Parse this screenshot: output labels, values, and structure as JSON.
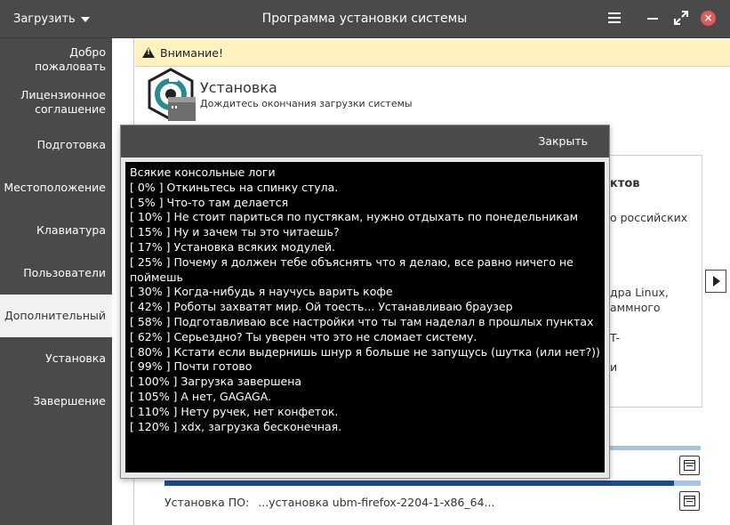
{
  "titlebar": {
    "menu_label": "Загрузить",
    "title": "Программа установки системы",
    "close_symbol": "×"
  },
  "sidebar": {
    "items": [
      {
        "label": "Добро пожаловать"
      },
      {
        "label": "Лицензионное соглашение"
      },
      {
        "label": "Подготовка"
      },
      {
        "label": "Местоположение"
      },
      {
        "label": "Клавиатура"
      },
      {
        "label": "Пользователи"
      },
      {
        "label": "Дополнительный",
        "active": true
      },
      {
        "label": "Установка"
      },
      {
        "label": "Завершение"
      }
    ]
  },
  "warning": {
    "text": "Внимание!"
  },
  "install": {
    "title": "Установка",
    "subtitle": "Дождитесь окончания загрузки системы"
  },
  "background_card": {
    "lines": [
      "ктов",
      "о российских",
      "дра Linux,",
      "аммного",
      "T-",
      "и"
    ]
  },
  "progress": {
    "fraction": 0.95,
    "status_label": "Установка ПО:",
    "status_value": "...установка ubm-firefox-2204-1-x86_64..."
  },
  "dialog": {
    "close_label": "Закрыть",
    "log_lines": [
      "Всякие консольные логи",
      "[ 0% ] Откиньтесь на спинку стула.",
      "[ 5% ] Что-то там делается",
      "[ 10% ] Не стоит париться по пустякам, нужно отдыхать по понедельникам",
      "[ 15% ] Ну и зачем ты это читаешь?",
      "[ 17% ] Установка всяких модулей.",
      "[ 25% ] Почему я должен тебе объяснять что я делаю, все равно ничего не поймешь",
      "[ 30% ] Когда-нибудь я научусь варить кофе",
      "[ 42% ] Роботы захватят мир. Ой тоесть... Устанавливаю браузер",
      "[ 58% ] Подготавливаю все настройки что ты там наделал в прошлых пунктах",
      "[ 62% ] Серьездно? Ты уверен что это не сломает систему.",
      "[ 80% ] Кстати если выдернишь шнур я больше не запущусь (шутка (или нет?))",
      "[ 99% ] Почти готово",
      "[ 100% ] Загрузка завершена",
      "[ 105% ] А нет, GAGAGA.",
      "[ 110% ] Нету ручек, нет конфеток.",
      "[ 120% ] xdx, загрузка бесконечная."
    ]
  },
  "icons": {
    "menu": "hamburger-icon",
    "minimize": "minimize-icon",
    "maximize": "maximize-icon",
    "close": "close-icon",
    "warning": "warning-icon",
    "next": "arrow-right-icon",
    "log": "log-icon"
  },
  "colors": {
    "titlebar": "#4a4a4a",
    "sidebar": "#4a4a4a",
    "warning_bg": "#fdf1c0",
    "close_button": "#e25a5a",
    "progress_fill": "#1b4b8f",
    "progress_track": "#a7c4e6",
    "logo_teal": "#2a8a91",
    "console_bg": "#000000"
  }
}
